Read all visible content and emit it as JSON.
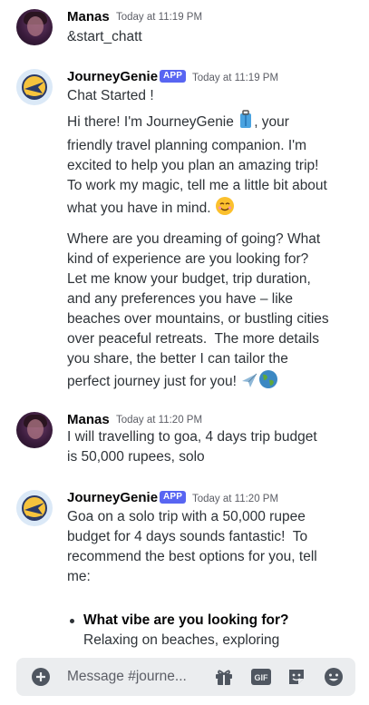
{
  "messages": [
    {
      "author": "Manas",
      "time": "Today at 11:19 PM",
      "text": "&start_chatt"
    },
    {
      "author": "JourneyGenie",
      "badge": "APP",
      "time": "Today at 11:19 PM",
      "line1": "Chat Started !",
      "p1a": "Hi there! I'm JourneyGenie ",
      "p1b": ", your friendly travel planning companion. I'm excited to help you plan an amazing trip!  To work my magic, tell me a little bit about what you have in mind. ",
      "p2": "Where are you dreaming of going? What kind of experience are you looking for? Let me know your budget, trip duration, and any preferences you have – like beaches over mountains, or bustling cities over peaceful retreats.  The more details you share, the better I can tailor the perfect journey just for you! "
    },
    {
      "author": "Manas",
      "time": "Today at 11:20 PM",
      "text": "I will travelling to goa, 4 days trip budget is 50,000 rupees, solo"
    },
    {
      "author": "JourneyGenie",
      "badge": "APP",
      "time": "Today at 11:20 PM",
      "text": "Goa on a solo trip with a 50,000 rupee budget for 4 days sounds fantastic!  To recommend the best options for you, tell me:",
      "bullet_bold": "What vibe are you looking for?",
      "bullet_text": "Relaxing on beaches, exploring historical sites, or taking adventure"
    }
  ],
  "composer": {
    "placeholder": "Message #journe..."
  },
  "icons": [
    "plus-circle-icon",
    "gift-icon",
    "gif-icon",
    "sticker-icon",
    "emoji-icon"
  ],
  "colors": {
    "app_badge": "#5865f2",
    "composer_bg": "#ebedef",
    "text": "#2e3338"
  }
}
